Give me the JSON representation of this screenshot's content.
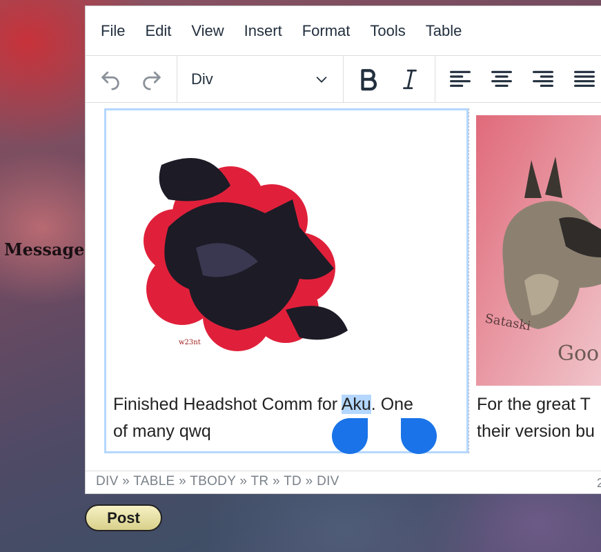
{
  "form": {
    "message_label": "Message",
    "post_label": "Post"
  },
  "editor": {
    "menu": [
      "File",
      "Edit",
      "View",
      "Insert",
      "Format",
      "Tools",
      "Table"
    ],
    "toolbar": {
      "format_value": "Div",
      "icons": [
        "undo-icon",
        "redo-icon",
        "chevron-down-icon",
        "bold-icon",
        "italic-icon",
        "align-left-icon",
        "align-center-icon",
        "align-right-icon",
        "align-justify-icon"
      ]
    },
    "cells": [
      {
        "text_before": "Finished Headshot Comm for ",
        "selected": "Aku",
        "text_after": ". One",
        "line2": "of many qwq",
        "image": "black-fox-artwork"
      },
      {
        "line1": "For the great T",
        "line2": "their version bu",
        "image": "grey-dragon-headshot"
      }
    ],
    "statusbar": {
      "path": "DIV » TABLE » TBODY » TR » TD » DIV",
      "right": "2"
    }
  },
  "colors": {
    "selection": "#b4d7ff",
    "handle": "#1a73e8",
    "text": "#222f3e"
  }
}
